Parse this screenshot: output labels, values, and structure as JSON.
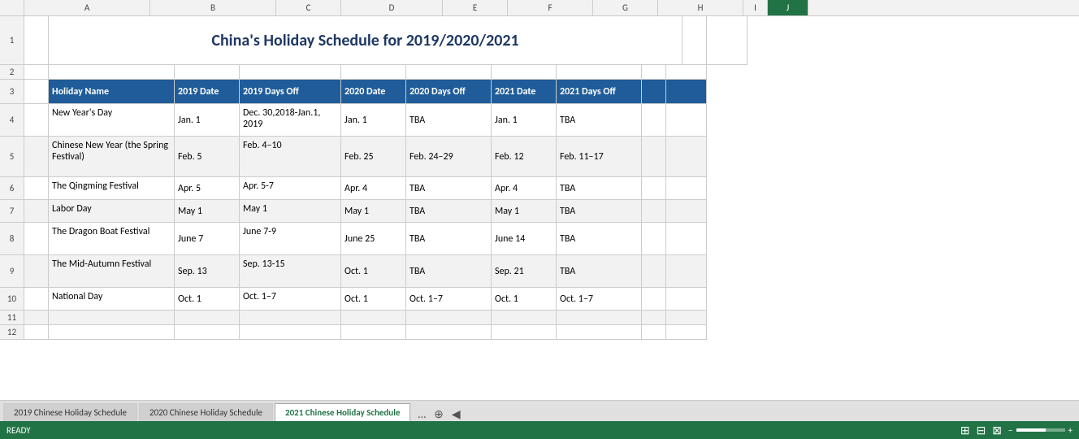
{
  "title": "China's Holiday Schedule for 2019/2020/2021",
  "headers": {
    "holiday": "Holiday Name",
    "date2019": "2019 Date",
    "off2019": "2019 Days Off",
    "date2020": "2020 Date",
    "off2020": "2020 Days Off",
    "date2021": "2021 Date",
    "off2021": "2021 Days Off"
  },
  "rows": [
    {
      "holiday": "New Year's Day",
      "date2019": "Jan. 1",
      "off2019": "Dec. 30,2018-Jan.1, 2019",
      "date2020": "Jan. 1",
      "off2020": "TBA",
      "date2021": "Jan. 1",
      "off2021": "TBA"
    },
    {
      "holiday": "Chinese New Year (the Spring Festival)",
      "date2019": "Feb. 5",
      "off2019": "Feb. 4–10",
      "date2020": "Feb. 25",
      "off2020": "Feb. 24–29",
      "date2021": "Feb. 12",
      "off2021": "Feb. 11–17"
    },
    {
      "holiday": "The Qingming Festival",
      "date2019": "Apr. 5",
      "off2019": "Apr. 5-7",
      "date2020": "Apr. 4",
      "off2020": "TBA",
      "date2021": "Apr. 4",
      "off2021": "TBA"
    },
    {
      "holiday": "Labor Day",
      "date2019": "May 1",
      "off2019": "May 1",
      "date2020": "May 1",
      "off2020": "TBA",
      "date2021": "May 1",
      "off2021": "TBA"
    },
    {
      "holiday": "The Dragon Boat Festival",
      "date2019": "June 7",
      "off2019": "June 7-9",
      "date2020": "June 25",
      "off2020": "TBA",
      "date2021": "June 14",
      "off2021": "TBA"
    },
    {
      "holiday": "The Mid-Autumn Festival",
      "date2019": "Sep. 13",
      "off2019": "Sep. 13-15",
      "date2020": "Oct. 1",
      "off2020": "TBA",
      "date2021": "Sep. 21",
      "off2021": "TBA"
    },
    {
      "holiday": "National Day",
      "date2019": "Oct. 1",
      "off2019": "Oct. 1–7",
      "date2020": "Oct. 1",
      "off2020": "Oct. 1–7",
      "date2021": "Oct. 1",
      "off2021": "Oct. 1–7"
    }
  ],
  "tabs": [
    {
      "label": "2019 Chinese Holiday Schedule",
      "active": false
    },
    {
      "label": "2020 Chinese Holiday Schedule",
      "active": false
    },
    {
      "label": "2021 Chinese Holiday Schedule",
      "active": true
    }
  ],
  "status": {
    "ready": "READY"
  },
  "columns": [
    "A",
    "B",
    "C",
    "D",
    "E",
    "F",
    "G",
    "H",
    "I",
    "J"
  ]
}
